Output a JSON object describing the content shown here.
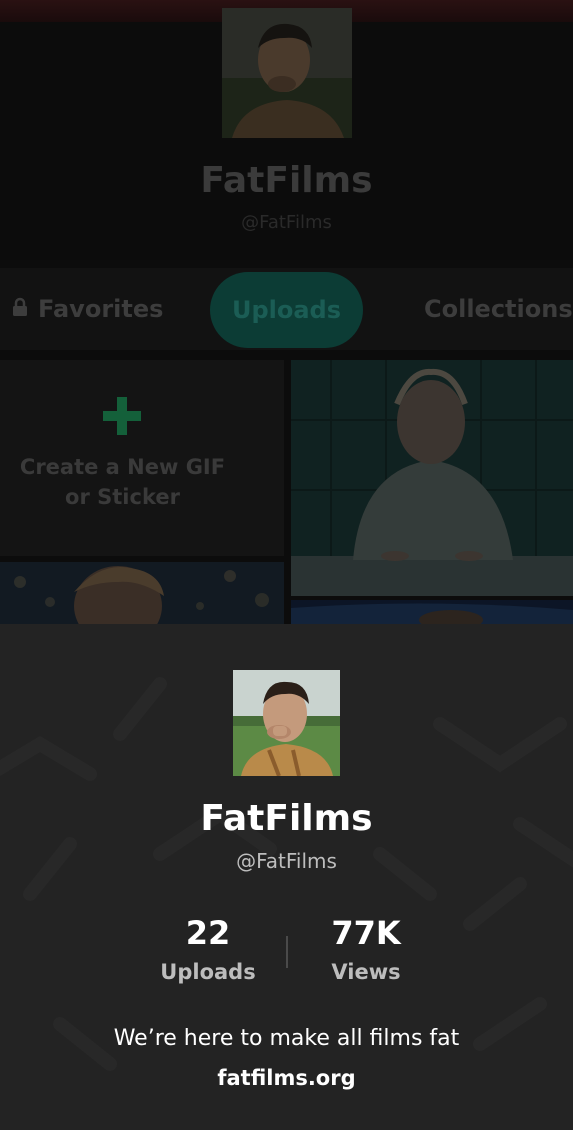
{
  "background_profile": {
    "name": "FatFilms",
    "handle": "@FatFilms"
  },
  "tabs": [
    {
      "label": "Favorites",
      "locked": true,
      "selected": false
    },
    {
      "label": "Uploads",
      "locked": false,
      "selected": true
    },
    {
      "label": "Collections",
      "locked": false,
      "selected": false
    }
  ],
  "create_tile": {
    "line1": "Create a New GIF",
    "line2": "or Sticker",
    "icon": "plus-icon"
  },
  "profile_card": {
    "name": "FatFilms",
    "handle": "@FatFilms",
    "stats": [
      {
        "value": "22",
        "label": "Uploads"
      },
      {
        "value": "77K",
        "label": "Views"
      }
    ],
    "bio": "We’re here to make all films fat",
    "website": "fatfilms.org"
  },
  "colors": {
    "accent_green": "#14603a",
    "selected_tab": "#0c3c35",
    "card_background": "#232323"
  }
}
